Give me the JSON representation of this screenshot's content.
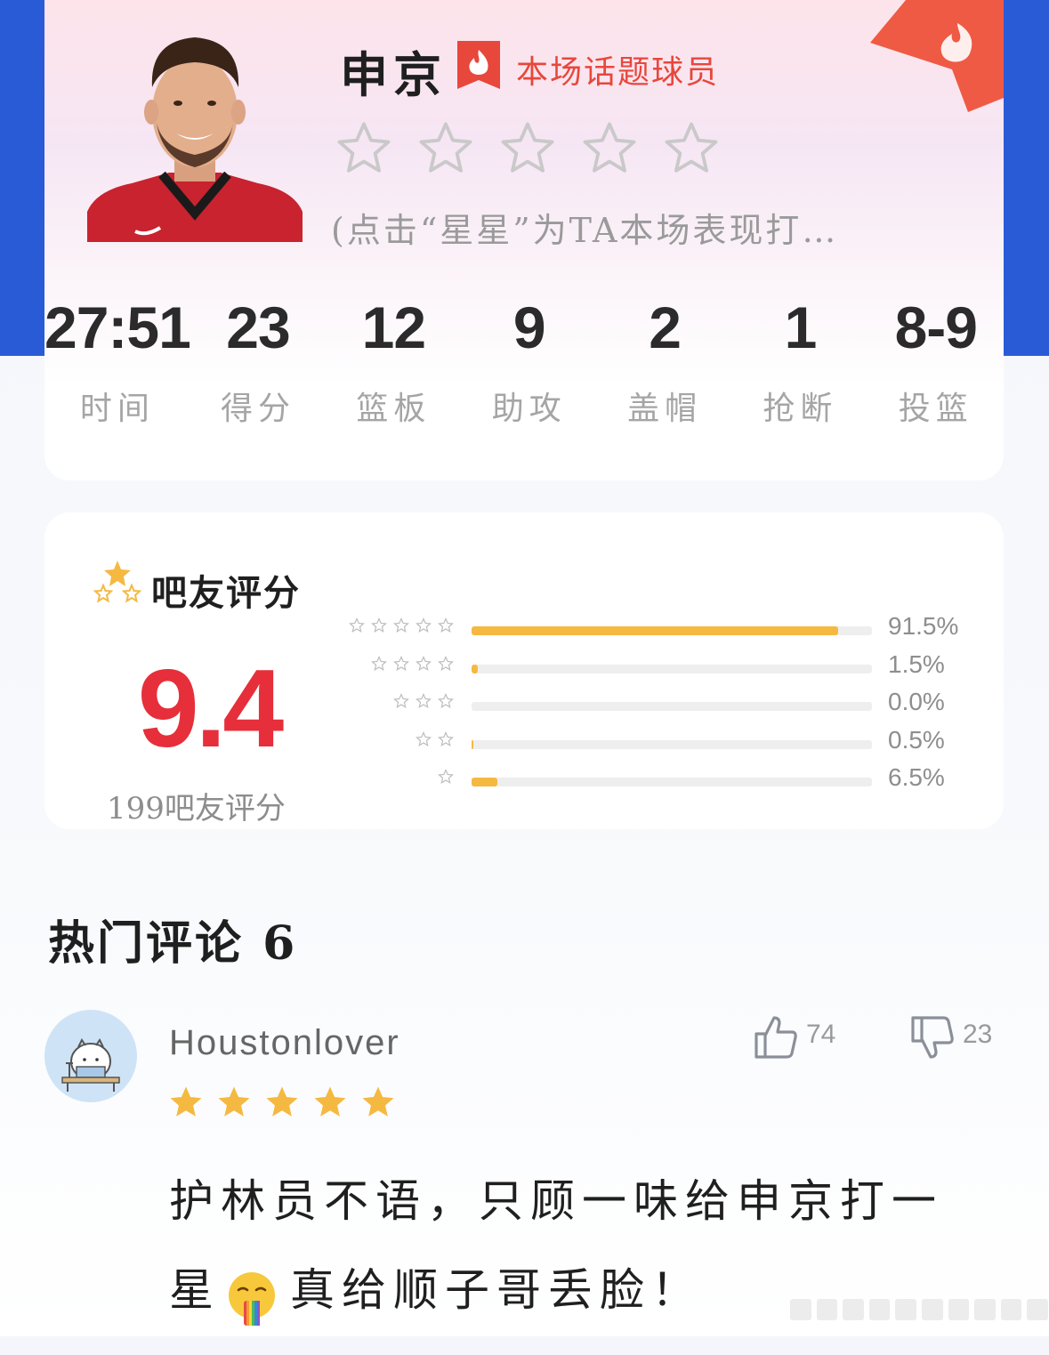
{
  "colors": {
    "accent_red": "#e62f3a",
    "star_gold": "#f5b941",
    "header_blue": "#2a5bd7"
  },
  "player": {
    "name": "申京",
    "topic_label": "本场话题球员",
    "rate_hint": "(点击“星星”为TA本场表现打…"
  },
  "stats": [
    {
      "value": "27:51",
      "label": "时间"
    },
    {
      "value": "23",
      "label": "得分"
    },
    {
      "value": "12",
      "label": "篮板"
    },
    {
      "value": "9",
      "label": "助攻"
    },
    {
      "value": "2",
      "label": "盖帽"
    },
    {
      "value": "1",
      "label": "抢断"
    },
    {
      "value": "8-9",
      "label": "投篮"
    }
  ],
  "rating": {
    "title": "吧友评分",
    "score": "9.4",
    "count_label": "199吧友评分",
    "distribution": [
      {
        "stars": 5,
        "fraction": 0.915,
        "percent": "91.5%"
      },
      {
        "stars": 4,
        "fraction": 0.015,
        "percent": "1.5%"
      },
      {
        "stars": 3,
        "fraction": 0.0,
        "percent": "0.0%"
      },
      {
        "stars": 2,
        "fraction": 0.005,
        "percent": "0.5%"
      },
      {
        "stars": 1,
        "fraction": 0.065,
        "percent": "6.5%"
      }
    ]
  },
  "comments": {
    "title": "热门评论 6",
    "items": [
      {
        "username": "Houstonlover",
        "stars": 5,
        "likes": "74",
        "dislikes": "23",
        "text_part1": "护林员不语，只顾一味给申京打一星",
        "emoji": "nauseated-rainbow-face",
        "text_part2": "真给顺子哥丢脸！"
      }
    ]
  }
}
